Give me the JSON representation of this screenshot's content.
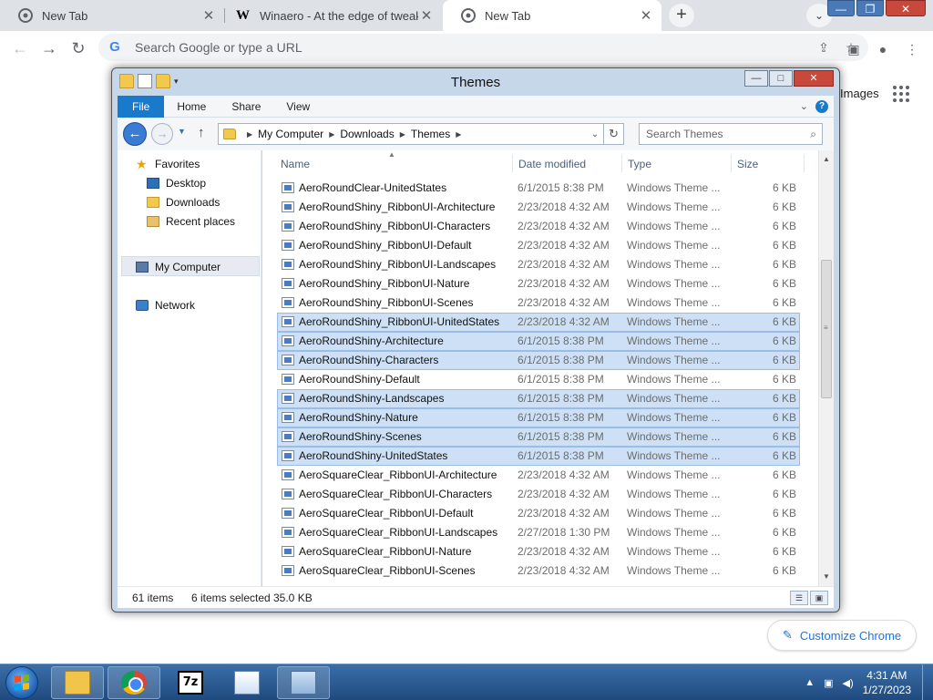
{
  "chrome": {
    "tabs": [
      {
        "label": "New Tab",
        "icon": "chrome-icon",
        "active": false
      },
      {
        "label": "Winaero - At the edge of tweaking",
        "icon": "winaero-icon",
        "active": false
      },
      {
        "label": "New Tab",
        "icon": "chrome-icon",
        "active": true
      }
    ],
    "tab_close_glyph": "✕",
    "new_tab_glyph": "+",
    "tab_search_glyph": "⌄",
    "window_controls": {
      "minimize": "—",
      "maximize": "❐",
      "close": "✕"
    },
    "omnibox_placeholder": "Search Google or type a URL",
    "google_glyph": "G",
    "images_link": "Images",
    "customize_label": "Customize Chrome"
  },
  "explorer": {
    "title": "Themes",
    "window_controls": {
      "minimize": "—",
      "maximize": "□",
      "close": "✕"
    },
    "ribbon_tabs": [
      "File",
      "Home",
      "Share",
      "View"
    ],
    "breadcrumb": [
      "My Computer",
      "Downloads",
      "Themes"
    ],
    "search_placeholder": "Search Themes",
    "nav_pane": {
      "favorites": "Favorites",
      "desktop": "Desktop",
      "downloads": "Downloads",
      "recent_places": "Recent places",
      "my_computer": "My Computer",
      "network": "Network"
    },
    "columns": [
      "Name",
      "Date modified",
      "Type",
      "Size"
    ],
    "files": [
      {
        "name": "AeroRoundClear-UnitedStates",
        "date": "6/1/2015 8:38 PM",
        "type": "Windows Theme ...",
        "size": "6 KB",
        "selected": false
      },
      {
        "name": "AeroRoundShiny_RibbonUI-Architecture",
        "date": "2/23/2018 4:32 AM",
        "type": "Windows Theme ...",
        "size": "6 KB",
        "selected": false
      },
      {
        "name": "AeroRoundShiny_RibbonUI-Characters",
        "date": "2/23/2018 4:32 AM",
        "type": "Windows Theme ...",
        "size": "6 KB",
        "selected": false
      },
      {
        "name": "AeroRoundShiny_RibbonUI-Default",
        "date": "2/23/2018 4:32 AM",
        "type": "Windows Theme ...",
        "size": "6 KB",
        "selected": false
      },
      {
        "name": "AeroRoundShiny_RibbonUI-Landscapes",
        "date": "2/23/2018 4:32 AM",
        "type": "Windows Theme ...",
        "size": "6 KB",
        "selected": false
      },
      {
        "name": "AeroRoundShiny_RibbonUI-Nature",
        "date": "2/23/2018 4:32 AM",
        "type": "Windows Theme ...",
        "size": "6 KB",
        "selected": false
      },
      {
        "name": "AeroRoundShiny_RibbonUI-Scenes",
        "date": "2/23/2018 4:32 AM",
        "type": "Windows Theme ...",
        "size": "6 KB",
        "selected": false
      },
      {
        "name": "AeroRoundShiny_RibbonUI-UnitedStates",
        "date": "2/23/2018 4:32 AM",
        "type": "Windows Theme ...",
        "size": "6 KB",
        "selected": true
      },
      {
        "name": "AeroRoundShiny-Architecture",
        "date": "6/1/2015 8:38 PM",
        "type": "Windows Theme ...",
        "size": "6 KB",
        "selected": true
      },
      {
        "name": "AeroRoundShiny-Characters",
        "date": "6/1/2015 8:38 PM",
        "type": "Windows Theme ...",
        "size": "6 KB",
        "selected": true
      },
      {
        "name": "AeroRoundShiny-Default",
        "date": "6/1/2015 8:38 PM",
        "type": "Windows Theme ...",
        "size": "6 KB",
        "selected": false
      },
      {
        "name": "AeroRoundShiny-Landscapes",
        "date": "6/1/2015 8:38 PM",
        "type": "Windows Theme ...",
        "size": "6 KB",
        "selected": true
      },
      {
        "name": "AeroRoundShiny-Nature",
        "date": "6/1/2015 8:38 PM",
        "type": "Windows Theme ...",
        "size": "6 KB",
        "selected": true
      },
      {
        "name": "AeroRoundShiny-Scenes",
        "date": "6/1/2015 8:38 PM",
        "type": "Windows Theme ...",
        "size": "6 KB",
        "selected": true
      },
      {
        "name": "AeroRoundShiny-UnitedStates",
        "date": "6/1/2015 8:38 PM",
        "type": "Windows Theme ...",
        "size": "6 KB",
        "selected": true
      },
      {
        "name": "AeroSquareClear_RibbonUI-Architecture",
        "date": "2/23/2018 4:32 AM",
        "type": "Windows Theme ...",
        "size": "6 KB",
        "selected": false
      },
      {
        "name": "AeroSquareClear_RibbonUI-Characters",
        "date": "2/23/2018 4:32 AM",
        "type": "Windows Theme ...",
        "size": "6 KB",
        "selected": false
      },
      {
        "name": "AeroSquareClear_RibbonUI-Default",
        "date": "2/23/2018 4:32 AM",
        "type": "Windows Theme ...",
        "size": "6 KB",
        "selected": false
      },
      {
        "name": "AeroSquareClear_RibbonUI-Landscapes",
        "date": "2/27/2018 1:30 PM",
        "type": "Windows Theme ...",
        "size": "6 KB",
        "selected": false
      },
      {
        "name": "AeroSquareClear_RibbonUI-Nature",
        "date": "2/23/2018 4:32 AM",
        "type": "Windows Theme ...",
        "size": "6 KB",
        "selected": false
      },
      {
        "name": "AeroSquareClear_RibbonUI-Scenes",
        "date": "2/23/2018 4:32 AM",
        "type": "Windows Theme ...",
        "size": "6 KB",
        "selected": false
      }
    ],
    "status": {
      "item_count": "61 items",
      "selected_count": "6 items selected",
      "selected_size": "35.0 KB"
    }
  },
  "taskbar": {
    "pinned": [
      "file-explorer-icon",
      "chrome-icon",
      "7zip-icon",
      "paint-icon",
      "control-panel-icon"
    ],
    "sevenzip_label": "7z",
    "tray_glyphs": {
      "show_hidden": "▲",
      "network": "▣",
      "volume": "◀)"
    },
    "time": "4:31 AM",
    "date": "1/27/2023"
  },
  "colors": {
    "chrome_tabbar": "#dee1e6",
    "explorer_frame": "#c6d7ea",
    "ribbon_file_tab": "#1979ca",
    "selection_fill": "#cde0f5",
    "selection_border": "#99bde6",
    "taskbar": "#1f4a7f"
  }
}
